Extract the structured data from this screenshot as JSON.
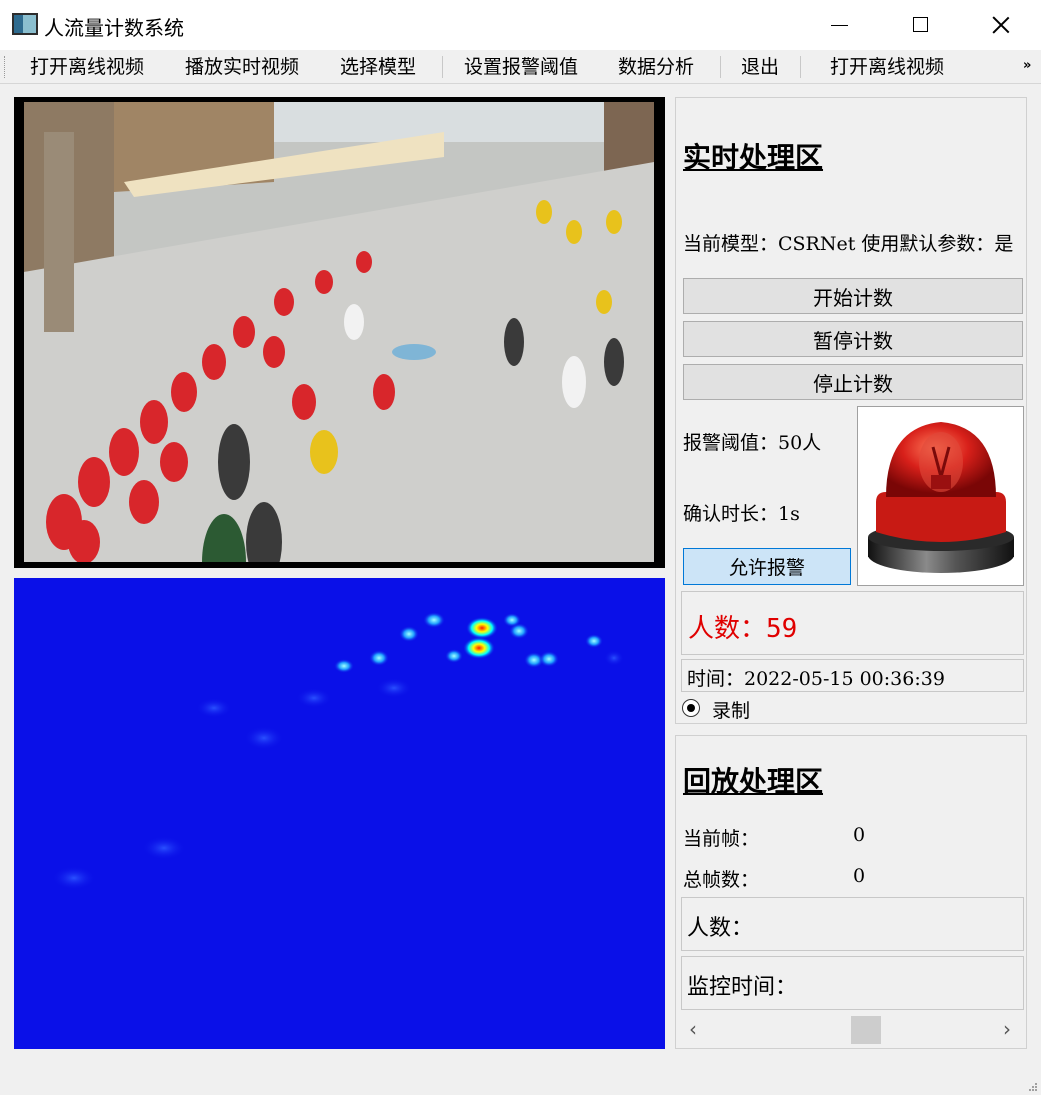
{
  "window": {
    "title": "人流量计数系统"
  },
  "toolbar": {
    "items": [
      "打开离线视频",
      "播放实时视频",
      "选择模型",
      "设置报警阈值",
      "数据分析",
      "退出",
      "打开离线视频"
    ],
    "more": "»"
  },
  "realtime": {
    "title": "实时处理区",
    "model_line": "当前模型：CSRNet 使用默认参数：是",
    "start_button": "开始计数",
    "pause_button": "暂停计数",
    "stop_button": "停止计数",
    "threshold_label": "报警阈值：50人",
    "confirm_label": "确认时长：1s",
    "allow_alarm_button": "允许报警",
    "count_label": "人数：",
    "count_value": "59",
    "time_label": "时间：2022-05-15 00:36:39",
    "record_label": "录制",
    "record_checked": true
  },
  "playback": {
    "title": "回放处理区",
    "current_frame_label": "当前帧：",
    "current_frame_value": "0",
    "total_frames_label": "总帧数：",
    "total_frames_value": "0",
    "count_label": "人数：",
    "monitor_time_label": "监控时间："
  },
  "icons": {
    "app": "app-icon",
    "alarm": "alarm-beacon-icon",
    "scroll_left": "chevron-left-icon",
    "scroll_right": "chevron-right-icon"
  },
  "colors": {
    "heatmap_bg": "#0a10e8",
    "count_red": "#e00000",
    "alarm_red": "#d8201a"
  }
}
